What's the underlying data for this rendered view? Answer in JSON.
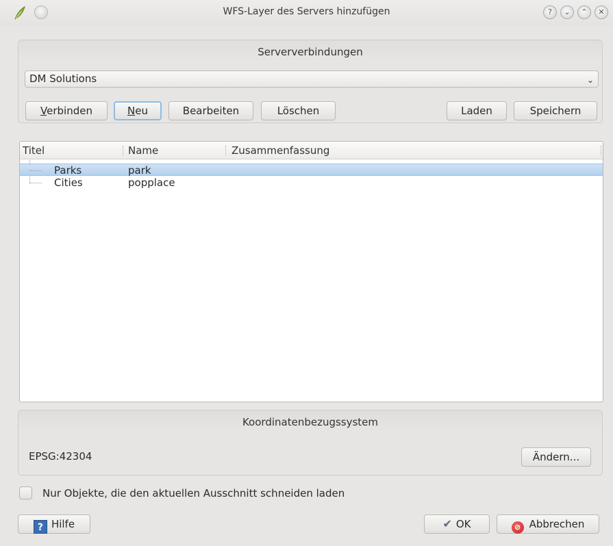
{
  "window": {
    "title": "WFS-Layer des Servers hinzufügen"
  },
  "server_connections": {
    "group_title": "Serververbindungen",
    "selected_connection": "DM Solutions",
    "buttons": {
      "connect_rest": "erbinden",
      "connect_mnemonic": "V",
      "new_rest": "eu",
      "new_mnemonic": "N",
      "edit": "Bearbeiten",
      "delete": "Löschen",
      "load": "Laden",
      "save": "Speichern"
    }
  },
  "layer_list": {
    "columns": [
      "Titel",
      "Name",
      "Zusammenfassung"
    ],
    "rows": [
      {
        "title": "Parks",
        "name": "park",
        "summary": "",
        "selected": true
      },
      {
        "title": "Cities",
        "name": "popplace",
        "summary": "",
        "selected": false
      }
    ]
  },
  "crs": {
    "group_title": "Koordinatenbezugssystem",
    "value": "EPSG:42304",
    "change_button": "Ändern..."
  },
  "filter_checkbox": {
    "label": "Nur Objekte, die den aktuellen Ausschnitt schneiden laden",
    "checked": false
  },
  "footer": {
    "help_button": "Hilfe",
    "ok_button": "OK",
    "cancel_button": "Abbrechen"
  },
  "icons": {
    "app": "qgis-leaf-icon",
    "selection_color": "#b3d2ee"
  }
}
